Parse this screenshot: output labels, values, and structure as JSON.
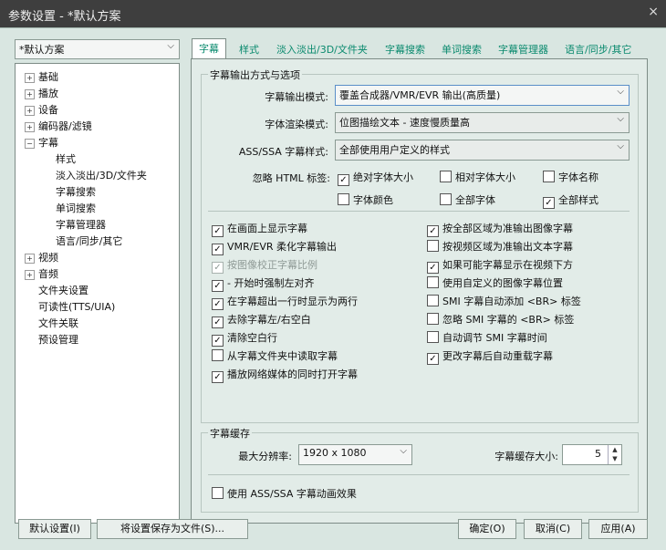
{
  "window": {
    "title": "参数设置 - *默认方案",
    "close": "×"
  },
  "profile": {
    "value": "*默认方案"
  },
  "tree": [
    {
      "label": "基础",
      "expander": "+"
    },
    {
      "label": "播放",
      "expander": "+"
    },
    {
      "label": "设备",
      "expander": "+"
    },
    {
      "label": "编码器/滤镜",
      "expander": "+"
    },
    {
      "label": "字幕",
      "expander": "−"
    },
    {
      "label": "样式"
    },
    {
      "label": "淡入淡出/3D/文件夹"
    },
    {
      "label": "字幕搜索"
    },
    {
      "label": "单词搜索"
    },
    {
      "label": "字幕管理器"
    },
    {
      "label": "语言/同步/其它"
    },
    {
      "label": "视频",
      "expander": "+"
    },
    {
      "label": "音频",
      "expander": "+"
    },
    {
      "label": "文件夹设置"
    },
    {
      "label": "可读性(TTS/UIA)"
    },
    {
      "label": "文件关联"
    },
    {
      "label": "预设管理"
    }
  ],
  "tabs": [
    "字幕",
    "样式",
    "淡入淡出/3D/文件夹",
    "字幕搜索",
    "单词搜索",
    "字幕管理器",
    "语言/同步/其它"
  ],
  "output_group": {
    "title": "字幕输出方式与选项",
    "output_mode_label": "字幕输出模式:",
    "output_mode_value": "覆盖合成器/VMR/EVR 输出(高质量)",
    "render_label": "字体渲染模式:",
    "render_value": "位图描绘文本 - 速度慢质量高",
    "ass_label": "ASS/SSA 字幕样式:",
    "ass_value": "全部使用用户定义的样式",
    "ignore_label": "忽略 HTML 标签:",
    "ignore_options": [
      {
        "label": "绝对字体大小",
        "checked": "✓"
      },
      {
        "label": "相对字体大小",
        "checked": ""
      },
      {
        "label": "字体名称",
        "checked": ""
      },
      {
        "label": "字体颜色",
        "checked": ""
      },
      {
        "label": "全部字体",
        "checked": ""
      },
      {
        "label": "全部样式",
        "checked": "✓"
      }
    ]
  },
  "options_left": [
    {
      "label": "在画面上显示字幕",
      "checked": "✓"
    },
    {
      "label": "VMR/EVR 柔化字幕输出",
      "checked": "✓"
    },
    {
      "label": "按图像校正字幕比例",
      "checked": "✓"
    },
    {
      "label": "- 开始时强制左对齐",
      "checked": "✓"
    },
    {
      "label": "在字幕超出一行时显示为两行",
      "checked": "✓"
    },
    {
      "label": "去除字幕左/右空白",
      "checked": "✓"
    },
    {
      "label": "清除空白行",
      "checked": "✓"
    },
    {
      "label": "从字幕文件夹中读取字幕",
      "checked": ""
    },
    {
      "label": "播放网络媒体的同时打开字幕",
      "checked": "✓"
    }
  ],
  "options_right": [
    {
      "label": "按全部区域为准输出图像字幕",
      "checked": "✓"
    },
    {
      "label": "按视频区域为准输出文本字幕",
      "checked": ""
    },
    {
      "label": "如果可能字幕显示在视频下方",
      "checked": "✓"
    },
    {
      "label": "使用自定义的图像字幕位置",
      "checked": ""
    },
    {
      "label": "SMI 字幕自动添加 <BR> 标签",
      "checked": ""
    },
    {
      "label": "忽略 SMI 字幕的 <BR> 标签",
      "checked": ""
    },
    {
      "label": "自动调节 SMI 字幕时间",
      "checked": ""
    },
    {
      "label": "更改字幕后自动重载字幕",
      "checked": "✓"
    }
  ],
  "cache_group": {
    "title": "字幕缓存",
    "max_res_label": "最大分辨率:",
    "max_res_value": "1920 x 1080",
    "cache_size_label": "字幕缓存大小:",
    "cache_size_value": "5",
    "anim_label": "使用 ASS/SSA 字幕动画效果",
    "anim_checked": ""
  },
  "buttons": {
    "default": "默认设置(I)",
    "save_file": "将设置保存为文件(S)...",
    "ok": "确定(O)",
    "cancel": "取消(C)",
    "apply": "应用(A)"
  },
  "glyphs": {
    "dropdown": "⌵",
    "spin_up": "▲",
    "spin_down": "▼"
  }
}
